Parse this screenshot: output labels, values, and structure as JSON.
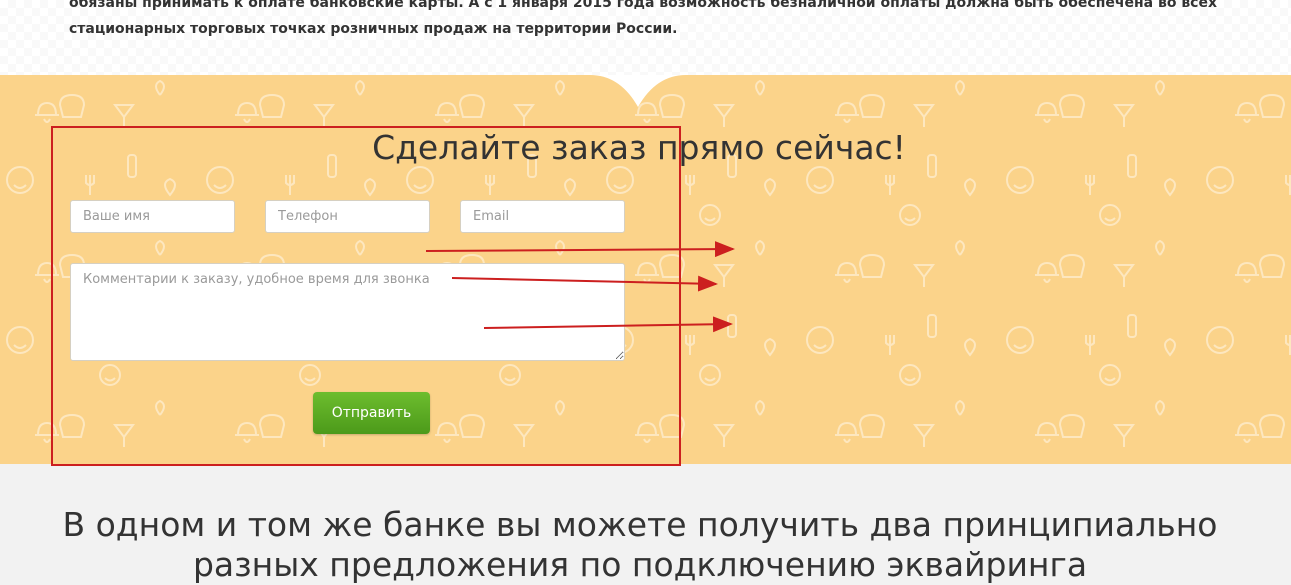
{
  "intro": {
    "text": "обязаны принимать к оплате банковские карты. А с 1 января 2015 года возможность безналичной оплаты должна быть обеспечена во всех стационарных торговых точках розничных продаж на территории России."
  },
  "order_form": {
    "title": "Сделайте заказ прямо сейчас!",
    "name_placeholder": "Ваше имя",
    "phone_placeholder": "Телефон",
    "email_placeholder": "Email",
    "comment_placeholder": "Комментарии к заказу, удобное время для звонка",
    "submit_label": "Отправить",
    "colors": {
      "background": "#fbd38a",
      "submit": "#5aab22",
      "annotation": "#cc1f1f"
    }
  },
  "bottom": {
    "heading": "В одном и том же банке вы можете получить два принципиально разных предложения по подключению эквайринга"
  }
}
